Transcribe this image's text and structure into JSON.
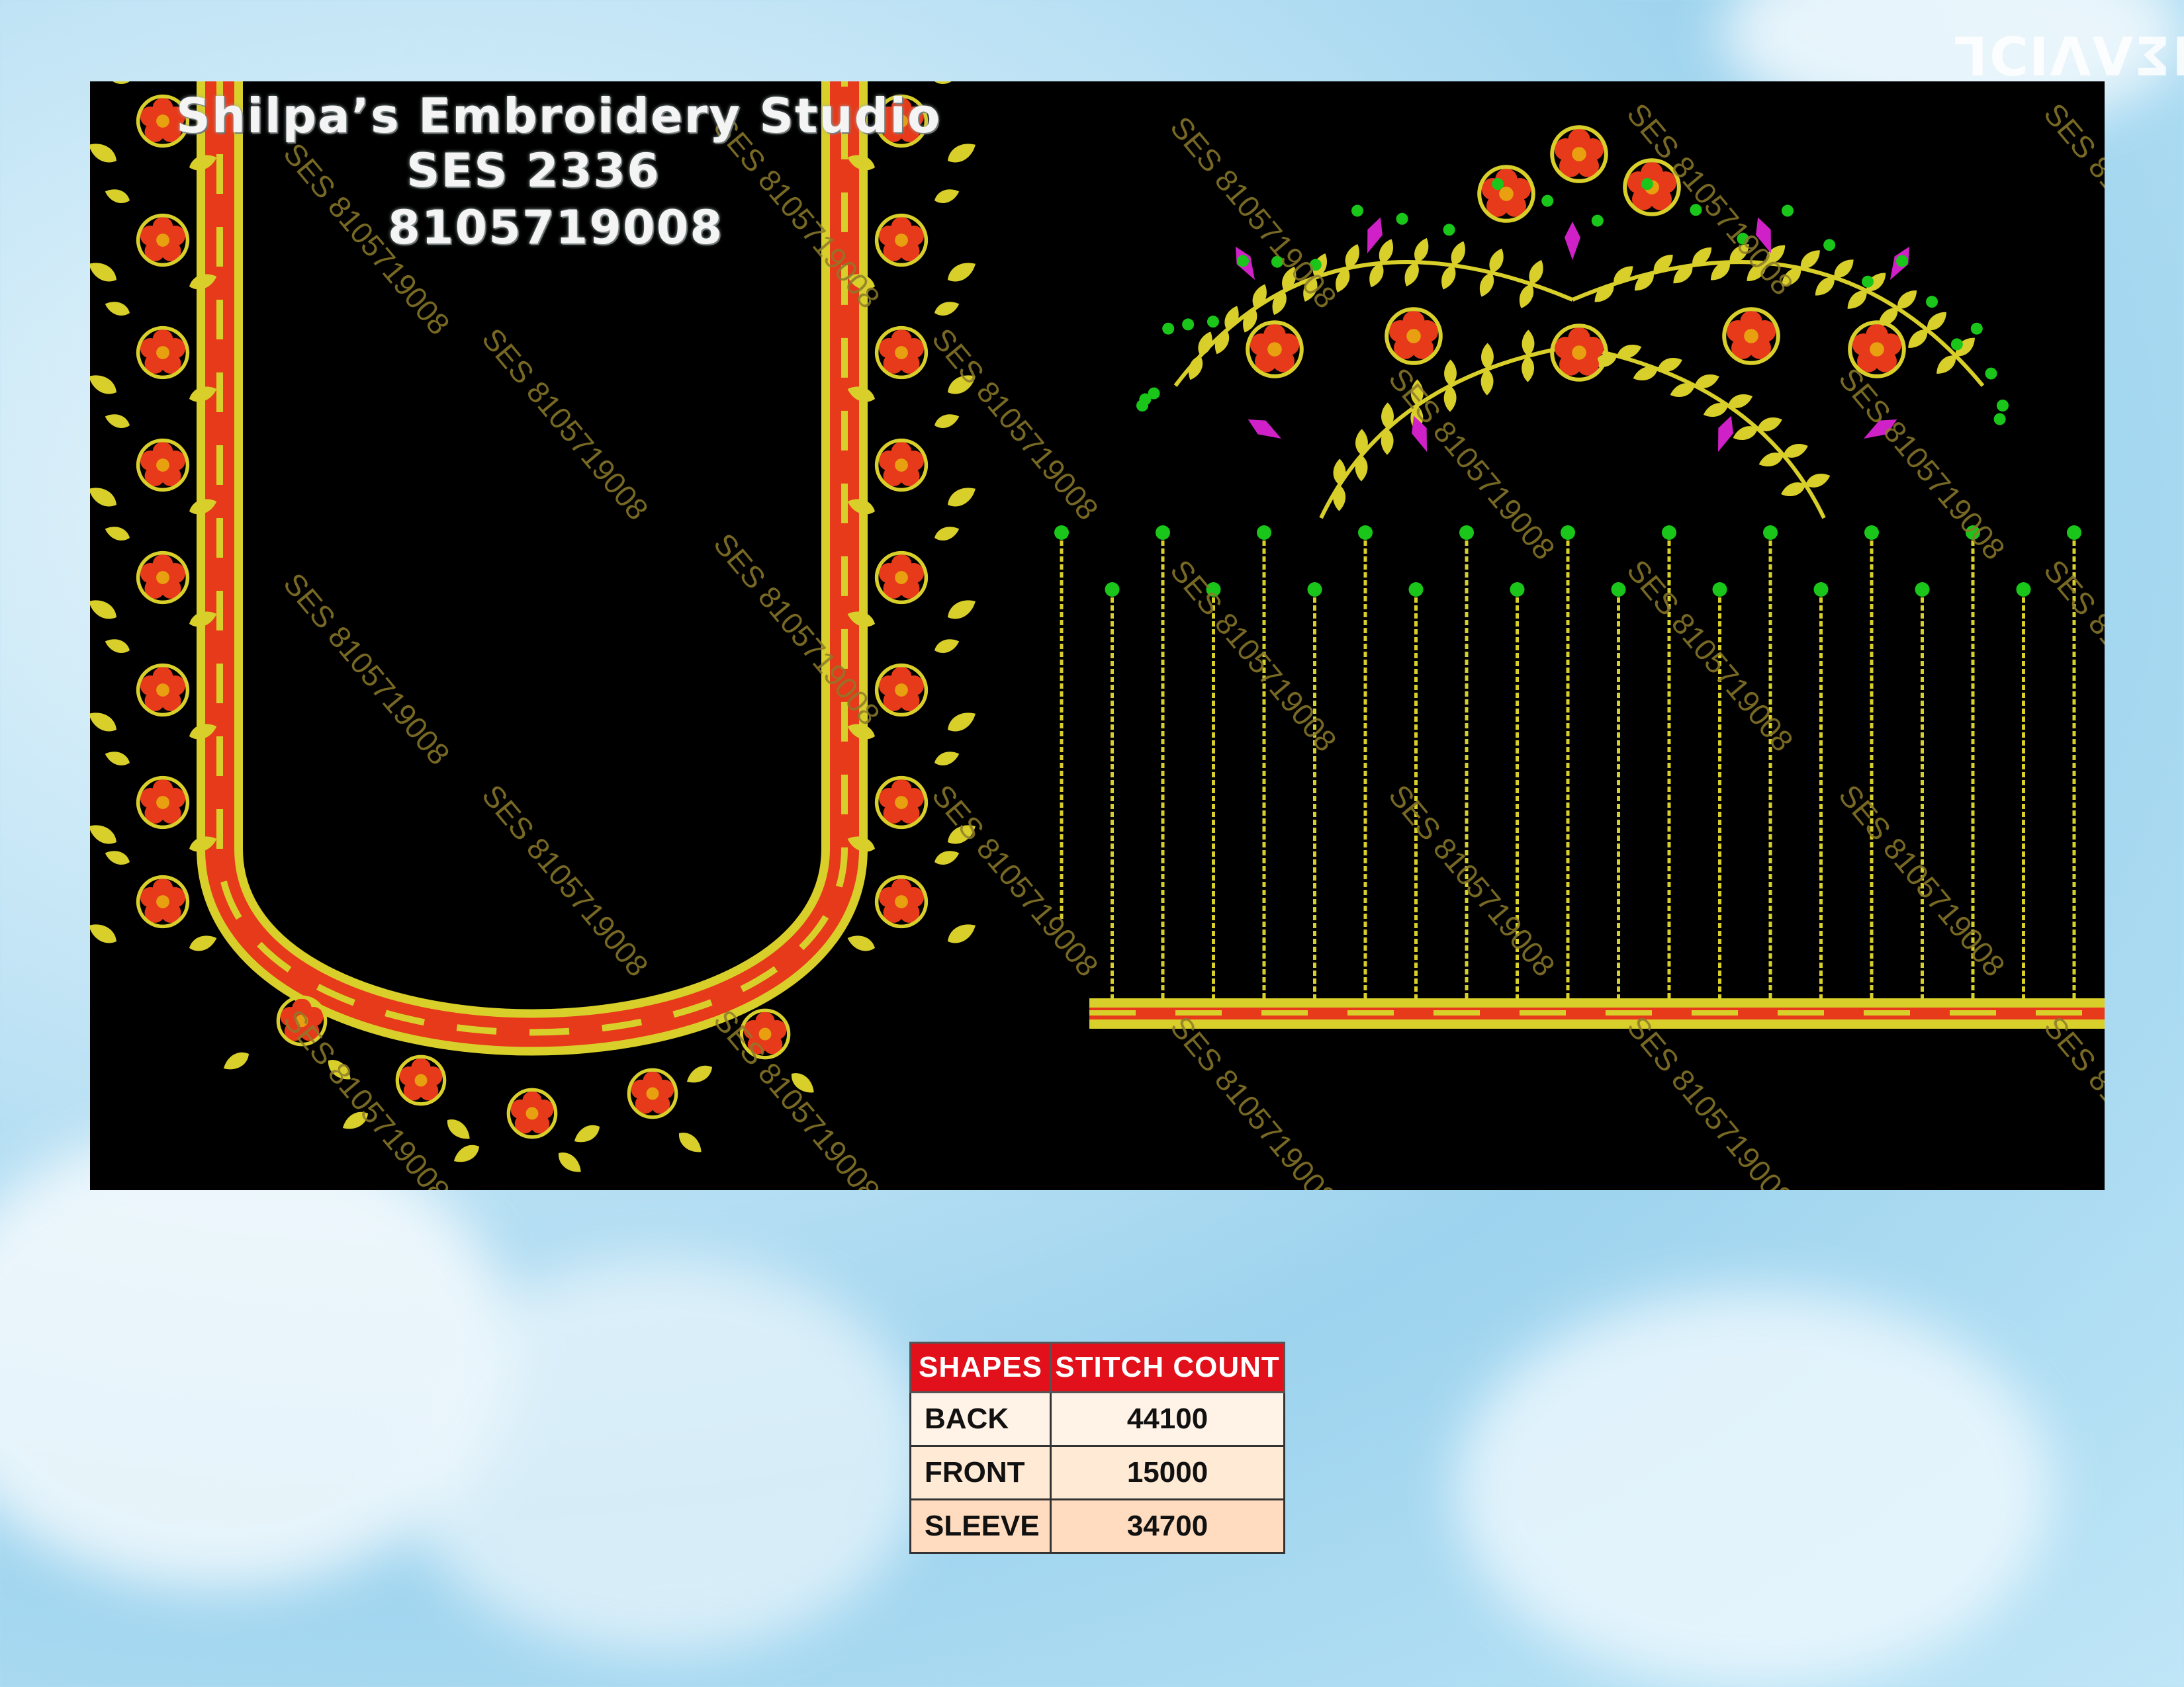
{
  "design": {
    "studio_name": "Shilpa’s Embroidery Studio",
    "design_code": "SES 2336",
    "phone": "8105719008",
    "watermark": "SES 8105719008",
    "corner_mark": "IΣVΛIƆΓ"
  },
  "colors": {
    "background": "#000000",
    "gold": "#d9cf2a",
    "red": "#e63a1a",
    "flower_center": "#e8a010",
    "magenta": "#d020c8",
    "bead_green": "#19c619",
    "table_header": "#e1101a"
  },
  "table": {
    "headers": [
      "SHAPES",
      "STITCH COUNT"
    ],
    "rows": [
      {
        "shape": "BACK",
        "count": "44100"
      },
      {
        "shape": "FRONT",
        "count": "15000"
      },
      {
        "shape": "SLEEVE",
        "count": "34700"
      }
    ]
  }
}
